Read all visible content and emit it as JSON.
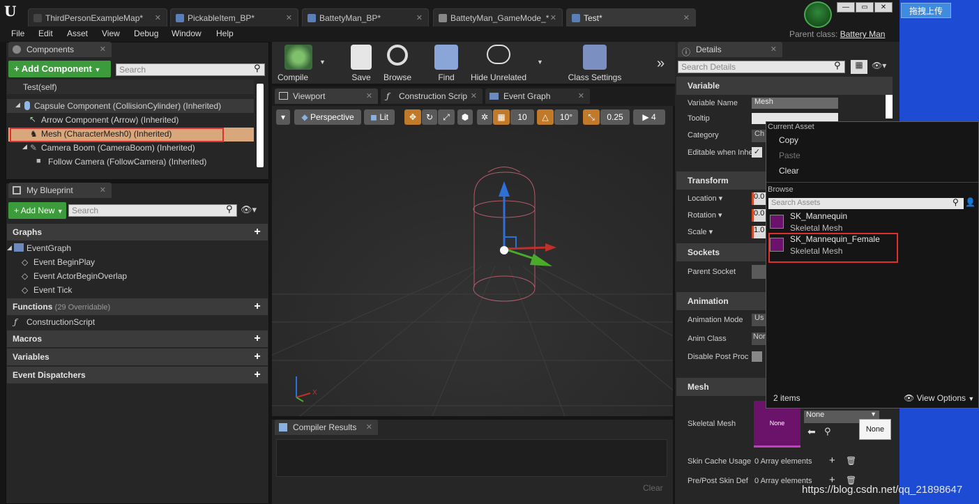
{
  "app": {
    "logo": "U"
  },
  "tabs": [
    {
      "label": "ThirdPersonExampleMap*",
      "icon": "map-icon"
    },
    {
      "label": "PickableItem_BP*",
      "icon": "blueprint-icon"
    },
    {
      "label": "BattetyMan_BP*",
      "icon": "blueprint-icon"
    },
    {
      "label": "BattetyMan_GameMode_*",
      "icon": "gamemode-icon"
    },
    {
      "label": "Test*",
      "icon": "blueprint-icon",
      "active": true
    }
  ],
  "menu": [
    "File",
    "Edit",
    "Asset",
    "View",
    "Debug",
    "Window",
    "Help"
  ],
  "parent_class": {
    "label": "Parent class:",
    "value": "Battery Man"
  },
  "upload_button": "拖拽上传",
  "components": {
    "tab": "Components",
    "add_button": "Add Component",
    "search_placeholder": "Search",
    "items": [
      "Test(self)",
      "Capsule Component (CollisionCylinder) (Inherited)",
      "Arrow Component (Arrow) (Inherited)",
      "Mesh (CharacterMesh0) (Inherited)",
      "Camera Boom (CameraBoom) (Inherited)",
      "Follow Camera (FollowCamera) (Inherited)"
    ]
  },
  "my_blueprint": {
    "tab": "My Blueprint",
    "add_button": "Add New",
    "search_placeholder": "Search",
    "graphs_label": "Graphs",
    "event_graph": "EventGraph",
    "events": [
      "Event BeginPlay",
      "Event ActorBeginOverlap",
      "Event Tick"
    ],
    "functions_label": "Functions",
    "functions_note": "(29 Overridable)",
    "construction_script": "ConstructionScript",
    "macros_label": "Macros",
    "variables_label": "Variables",
    "dispatchers_label": "Event Dispatchers"
  },
  "toolbar": {
    "compile": "Compile",
    "save": "Save",
    "browse": "Browse",
    "find": "Find",
    "hide_unrelated": "Hide Unrelated",
    "class_settings": "Class Settings"
  },
  "editor_tabs": [
    "Viewport",
    "Construction Scrip",
    "Event Graph"
  ],
  "viewport": {
    "perspective": "Perspective",
    "lit": "Lit",
    "grid_snap": "10",
    "rot_snap": "10°",
    "scale_snap": "0.25",
    "cam_speed": "4"
  },
  "compiler": {
    "tab": "Compiler Results",
    "clear": "Clear"
  },
  "details": {
    "tab": "Details",
    "search_placeholder": "Search Details",
    "variable_section": "Variable",
    "variable_name_label": "Variable Name",
    "variable_name_value": "Mesh",
    "tooltip_label": "Tooltip",
    "category_label": "Category",
    "category_value": "Ch",
    "editable_label": "Editable when Inhe",
    "transform_section": "Transform",
    "location_label": "Location",
    "location_value": "0.0",
    "rotation_label": "Rotation",
    "rotation_value": "0.0",
    "scale_label": "Scale",
    "scale_value": "1.0",
    "sockets_section": "Sockets",
    "parent_socket_label": "Parent Socket",
    "animation_section": "Animation",
    "anim_mode_label": "Animation Mode",
    "anim_mode_value": "Us",
    "anim_class_label": "Anim Class",
    "anim_class_value": "Nor",
    "disable_post_label": "Disable Post Proc",
    "mesh_section": "Mesh",
    "skeletal_mesh_label": "Skeletal Mesh",
    "mesh_thumb": "None",
    "mesh_combo": "None",
    "tooltip_none": "None",
    "skin_cache_label": "Skin Cache Usage",
    "skin_cache_value": "0 Array elements",
    "prepost_label": "Pre/Post Skin Def",
    "prepost_value": "0 Array elements"
  },
  "popup": {
    "current_asset": "Current Asset",
    "copy": "Copy",
    "paste": "Paste",
    "clear": "Clear",
    "browse": "Browse",
    "search_placeholder": "Search Assets",
    "assets": [
      {
        "name": "SK_Mannequin",
        "type": "Skeletal Mesh"
      },
      {
        "name": "SK_Mannequin_Female",
        "type": "Skeletal Mesh"
      }
    ],
    "count": "2 items",
    "view_options": "View Options"
  },
  "watermark": "https://blog.csdn.net/qq_21898647",
  "colors": {
    "accent_green": "#3c9b3a",
    "highlight_red": "#e0302e",
    "mesh_thumb": "#6b136b",
    "selection": "#d8a77c"
  }
}
